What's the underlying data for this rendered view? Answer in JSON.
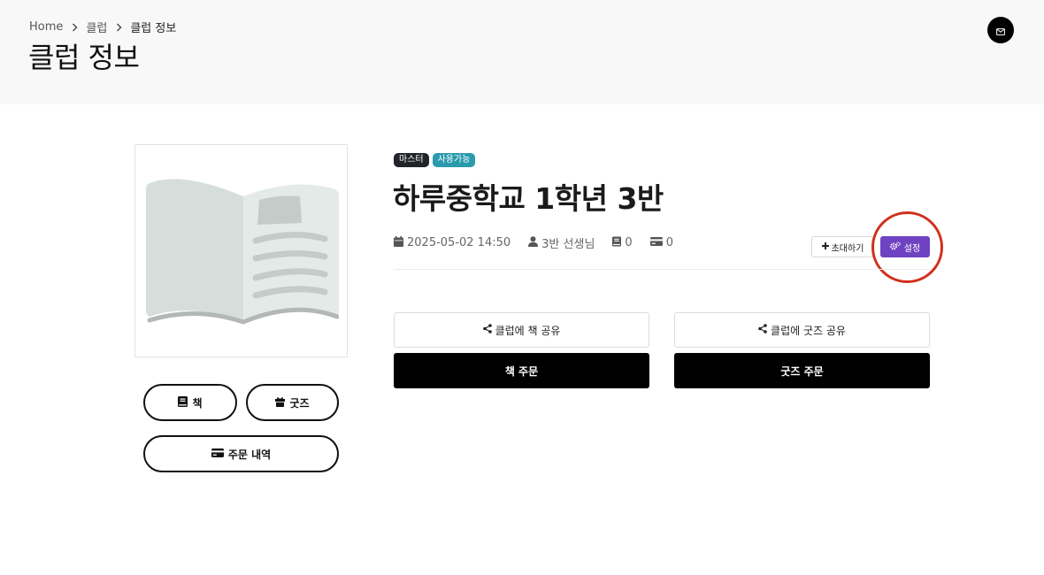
{
  "breadcrumb": {
    "home": "Home",
    "club": "클럽",
    "current": "클럽 정보"
  },
  "page_title": "클럽 정보",
  "header": {
    "mail_icon": "envelope-icon"
  },
  "cover": {
    "icon": "open-book-icon"
  },
  "left_buttons": {
    "books": "책",
    "goods": "굿즈",
    "order_history": "주문 내역"
  },
  "club": {
    "badges": [
      "마스터",
      "사용가능"
    ],
    "name": "하루중학교 1학년 3반",
    "created_at": "2025-05-02 14:50",
    "owner": "3반 선생님",
    "book_count": "0",
    "goods_count": "0"
  },
  "actions": {
    "invite": "초대하기",
    "settings": "설정",
    "share_book": "클럽에 책 공유",
    "share_goods": "클럽에 굿즈 공유",
    "order_book": "책 주문",
    "order_goods": "굿즈 주문"
  },
  "colors": {
    "settings_button": "#6f42c1",
    "badge_master": "#212529",
    "badge_available": "#2a9aad",
    "highlight_ring": "#d0301c"
  }
}
